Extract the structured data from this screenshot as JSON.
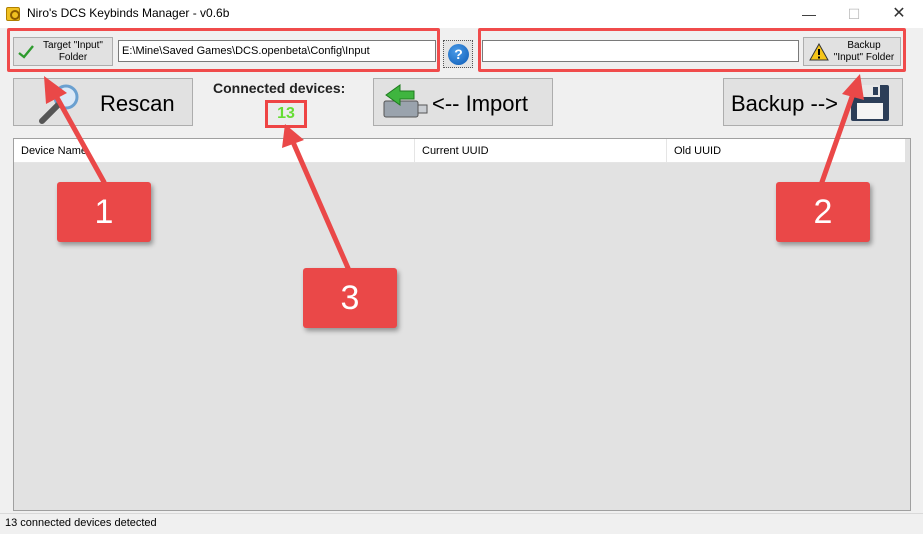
{
  "window": {
    "title": "Niro's DCS Keybinds Manager - v0.6b",
    "minimize_glyph": "—",
    "maximize_glyph": "☐",
    "close_glyph": "✕"
  },
  "toolbar": {
    "target_folder_label": "Target \"Input\"\nFolder",
    "target_path": "E:\\Mine\\Saved Games\\DCS.openbeta\\Config\\Input",
    "help_label": "?",
    "backup_path": "",
    "backup_folder_label": "Backup\n\"Input\" Folder"
  },
  "actions": {
    "rescan_label": "Rescan",
    "import_label": "<-- Import",
    "backup_label": "Backup -->"
  },
  "devices": {
    "connected_label": "Connected devices:",
    "count": "13"
  },
  "table": {
    "columns": [
      "Device Name",
      "Current UUID",
      "Old UUID"
    ],
    "rows": []
  },
  "status": {
    "text": "13 connected devices detected"
  },
  "annotations": {
    "callouts": [
      "1",
      "2",
      "3"
    ],
    "color": "#ea4848"
  },
  "colors": {
    "count_text": "#66dd33",
    "help_blue": "#0d5bb5"
  },
  "icons": [
    "app-key-icon",
    "checkmark-icon",
    "help-icon",
    "warning-icon",
    "magnifier-icon",
    "usb-drive-icon",
    "floppy-disk-icon"
  ]
}
